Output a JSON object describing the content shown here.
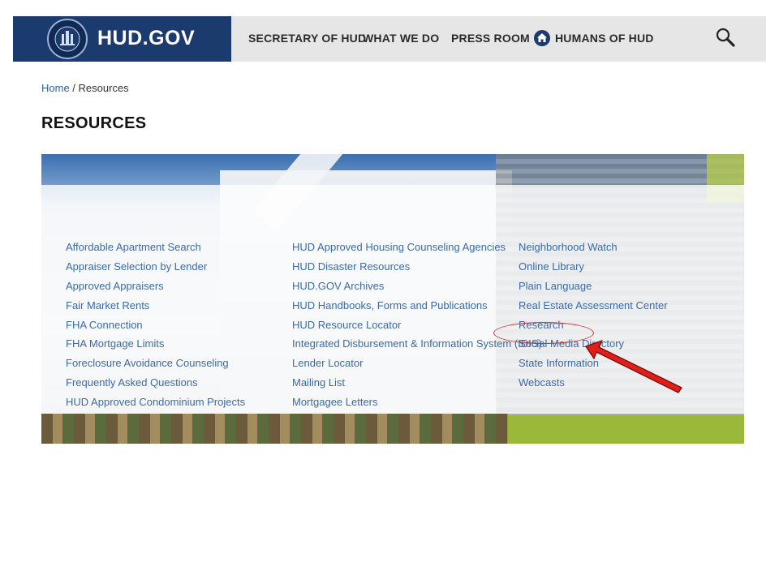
{
  "header": {
    "brand": "HUD.GOV",
    "nav": [
      "SECRETARY OF HUD",
      "WHAT WE DO",
      "PRESS ROOM",
      "HUMANS OF HUD"
    ]
  },
  "breadcrumb": {
    "home": "Home",
    "separator": " / ",
    "current": "Resources"
  },
  "page_title": "RESOURCES",
  "resources": {
    "col1": [
      "Affordable Apartment Search",
      "Appraiser Selection by Lender",
      "Approved Appraisers",
      "Fair Market Rents",
      "FHA Connection",
      "FHA Mortgage Limits",
      "Foreclosure Avoidance Counseling",
      "Frequently Asked Questions",
      "HUD Approved Condominium Projects"
    ],
    "col2": [
      "HUD Approved Housing Counseling Agencies",
      "HUD Disaster Resources",
      "HUD.GOV Archives",
      "HUD Handbooks, Forms and Publications",
      "HUD Resource Locator",
      "Integrated Disbursement & Information System (IDIS)",
      "Lender Locator",
      "Mailing List",
      "Mortgagee Letters"
    ],
    "col3": [
      "Neighborhood Watch",
      "Online Library",
      "Plain Language",
      "Real Estate Assessment Center",
      "Research",
      "Social Media Directory",
      "State Information",
      "Webcasts"
    ]
  },
  "colors": {
    "brand_navy": "#1b3a6d",
    "link": "#3a6aa8",
    "annotation_red": "#d9302a"
  },
  "icons": [
    "hud-seal-icon",
    "home-icon",
    "search-icon",
    "red-arrow-icon"
  ]
}
